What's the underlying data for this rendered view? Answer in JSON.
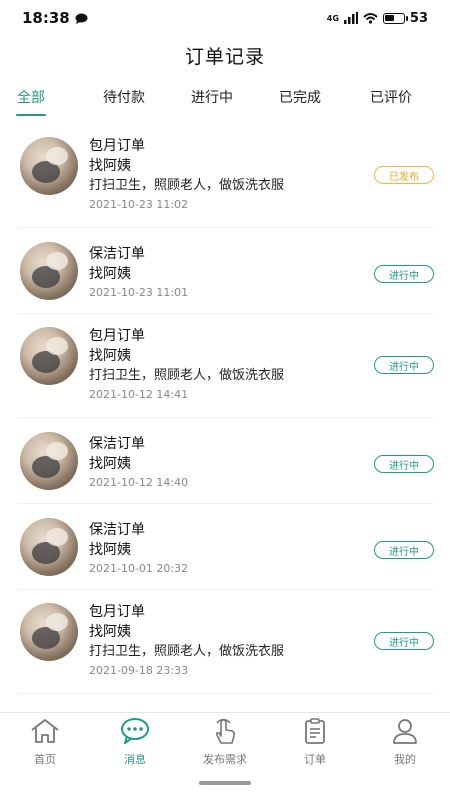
{
  "status_bar": {
    "time": "18:38",
    "network": "4G",
    "battery": "53",
    "battery_level": 0.53
  },
  "header": {
    "title": "订单记录"
  },
  "tabs": [
    {
      "label": "全部",
      "active": true
    },
    {
      "label": "待付款",
      "active": false
    },
    {
      "label": "进行中",
      "active": false
    },
    {
      "label": "已完成",
      "active": false
    },
    {
      "label": "已评价",
      "active": false
    }
  ],
  "orders": [
    {
      "type": "包月订单",
      "name": "找阿姨",
      "desc": "打扫卫生，照顾老人，做饭洗衣服",
      "time": "2021-10-23 11:02",
      "status": "已发布",
      "status_kind": "published"
    },
    {
      "type": "保洁订单",
      "name": "找阿姨",
      "desc": "",
      "time": "2021-10-23 11:01",
      "status": "进行中",
      "status_kind": "progress"
    },
    {
      "type": "包月订单",
      "name": "找阿姨",
      "desc": "打扫卫生，照顾老人，做饭洗衣服",
      "time": "2021-10-12 14:41",
      "status": "进行中",
      "status_kind": "progress"
    },
    {
      "type": "保洁订单",
      "name": "找阿姨",
      "desc": "",
      "time": "2021-10-12 14:40",
      "status": "进行中",
      "status_kind": "progress"
    },
    {
      "type": "保洁订单",
      "name": "找阿姨",
      "desc": "",
      "time": "2021-10-01 20:32",
      "status": "进行中",
      "status_kind": "progress"
    },
    {
      "type": "包月订单",
      "name": "找阿姨",
      "desc": "打扫卫生，照顾老人，做饭洗衣服",
      "time": "2021-09-18 23:33",
      "status": "进行中",
      "status_kind": "progress"
    }
  ],
  "bottom_nav": [
    {
      "label": "首页",
      "icon": "home-icon",
      "active": false
    },
    {
      "label": "消息",
      "icon": "chat-icon",
      "active": true
    },
    {
      "label": "发布需求",
      "icon": "tap-hand-icon",
      "active": false
    },
    {
      "label": "订单",
      "icon": "clipboard-icon",
      "active": false
    },
    {
      "label": "我的",
      "icon": "user-icon",
      "active": false
    }
  ],
  "colors": {
    "accent": "#1f9c86",
    "published": "#f0a623",
    "nav_inactive": "#777777"
  }
}
